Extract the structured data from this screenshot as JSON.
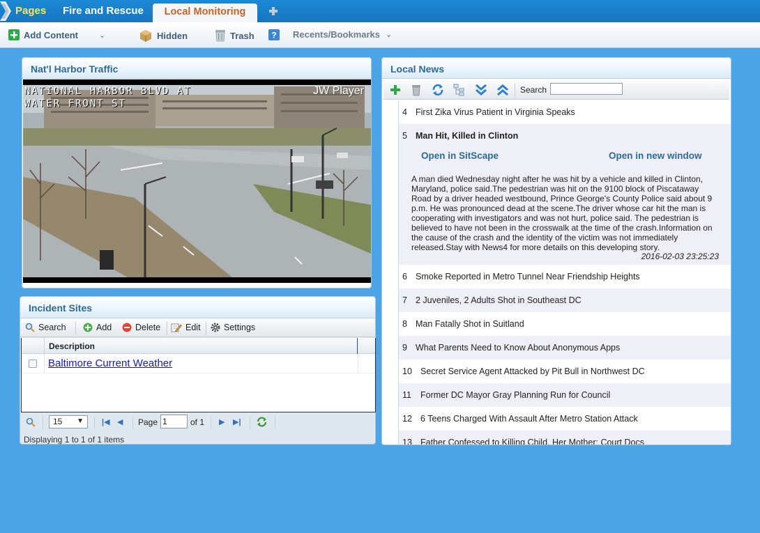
{
  "tabs": {
    "pages_label": "Pages",
    "items": [
      "Fire and Rescue",
      "Local Monitoring"
    ]
  },
  "toolbar": {
    "add_content": "Add Content",
    "hidden": "Hidden",
    "trash": "Trash",
    "recents": "Recents/Bookmarks"
  },
  "traffic": {
    "title": "Nat'l Harbor Traffic",
    "cam_line1": "NATIONAL HARBOR BLVD AT",
    "cam_line2": "WATER FRONT ST",
    "player": "JW Player"
  },
  "incident": {
    "title": "Incident Sites",
    "toolbar": {
      "search": "Search",
      "add": "Add",
      "delete": "Delete",
      "edit": "Edit",
      "settings": "Settings"
    },
    "column": "Description",
    "rows": [
      "Baltimore Current Weather"
    ],
    "page_size": "15",
    "page_label": "Page",
    "page_value": "1",
    "of_label": "of 1",
    "display_info": "Displaying 1 to 1 of 1 items"
  },
  "news": {
    "title": "Local News",
    "search_label": "Search",
    "items": [
      {
        "num": "4",
        "title": "First Zika Virus Patient in Virginia Speaks"
      },
      {
        "num": "5",
        "title": "Man Hit, Killed in Clinton"
      },
      {
        "num": "6",
        "title": "Smoke Reported in Metro Tunnel Near Friendship Heights"
      },
      {
        "num": "7",
        "title": "2 Juveniles, 2 Adults Shot in Southeast DC"
      },
      {
        "num": "8",
        "title": "Man Fatally Shot in Suitland"
      },
      {
        "num": "9",
        "title": "What Parents Need to Know About Anonymous Apps"
      },
      {
        "num": "10",
        "title": "Secret Service Agent Attacked by Pit Bull in Northwest DC"
      },
      {
        "num": "11",
        "title": "Former DC Mayor Gray Planning Run for Council"
      },
      {
        "num": "12",
        "title": "6 Teens Charged With Assault After Metro Station Attack"
      },
      {
        "num": "13",
        "title": "Father Confessed to Killing Child, Her Mother: Court Docs"
      }
    ],
    "expanded": {
      "open_sitscape": "Open in SitScape",
      "open_new": "Open in new window",
      "body": "A man died Wednesday night after he was hit by a vehicle and killed in Clinton, Maryland, police said.The pedestrian was hit on the 9100 block of Piscataway Road by a driver headed westbound, Prince George's County Police said about 9 p.m. He was pronounced dead at the scene.The driver whose car hit the man is cooperating with investigators and was not hurt, police said. The pedestrian is believed to have not been in the crosswalk at the time of the crash.Information on the cause of the crash and the identity of the victim was not immediately released.Stay with News4 for more details on this developing story.",
      "timestamp": "2016-02-03 23:25:23"
    }
  }
}
